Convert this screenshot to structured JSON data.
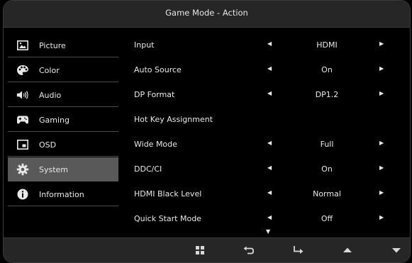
{
  "title": "Game Mode - Action",
  "sidebar": {
    "items": [
      {
        "label": "Picture",
        "icon": "picture-icon"
      },
      {
        "label": "Color",
        "icon": "palette-icon"
      },
      {
        "label": "Audio",
        "icon": "speaker-icon"
      },
      {
        "label": "Gaming",
        "icon": "gamepad-icon"
      },
      {
        "label": "OSD",
        "icon": "osd-window-icon"
      },
      {
        "label": "System",
        "icon": "gear-icon",
        "active": true
      },
      {
        "label": "Information",
        "icon": "info-icon"
      }
    ]
  },
  "settings": [
    {
      "label": "Input",
      "value": "HDMI",
      "arrows": true
    },
    {
      "label": "Auto Source",
      "value": "On",
      "arrows": true
    },
    {
      "label": "DP Format",
      "value": "DP1.2",
      "arrows": true
    },
    {
      "label": "Hot Key Assignment",
      "value": "",
      "arrows": false
    },
    {
      "label": "Wide Mode",
      "value": "Full",
      "arrows": true
    },
    {
      "label": "DDC/CI",
      "value": "On",
      "arrows": true
    },
    {
      "label": "HDMI Black Level",
      "value": "Normal",
      "arrows": true
    },
    {
      "label": "Quick Start Mode",
      "value": "Off",
      "arrows": true
    }
  ],
  "arrows": {
    "left": "◀",
    "right": "▶",
    "down": "▼"
  },
  "footer_buttons": [
    "menu-grid-icon",
    "back-icon",
    "enter-icon",
    "up-icon",
    "down-icon"
  ]
}
